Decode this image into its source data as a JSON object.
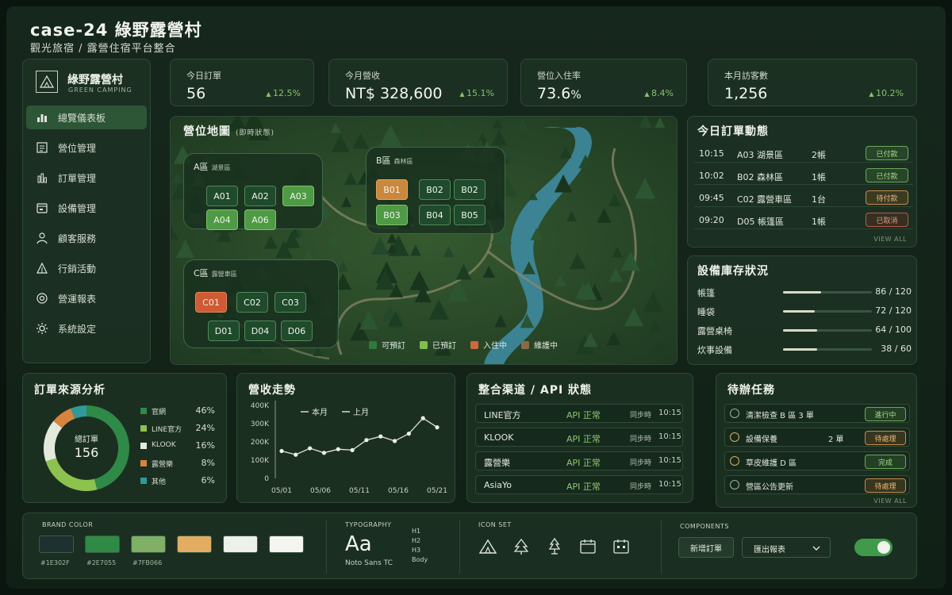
{
  "header": {
    "title": "case-24  綠野露營村",
    "subtitle": "觀光旅宿  /  露營住宿平台整合"
  },
  "sidebar": {
    "brand_name": "綠野露營村",
    "brand_en": "GREEN CAMPING",
    "items": [
      {
        "label": "總覽儀表板",
        "icon": "dashboard-icon",
        "active": true
      },
      {
        "label": "營位管理",
        "icon": "site-grid-icon"
      },
      {
        "label": "訂單管理",
        "icon": "orders-icon"
      },
      {
        "label": "設備管理",
        "icon": "equipment-icon"
      },
      {
        "label": "顧客服務",
        "icon": "customer-icon"
      },
      {
        "label": "行銷活動",
        "icon": "marketing-icon"
      },
      {
        "label": "營運報表",
        "icon": "report-icon"
      },
      {
        "label": "系統設定",
        "icon": "gear-icon"
      }
    ]
  },
  "kpis": [
    {
      "label": "今日訂單",
      "value": "56",
      "unit": "",
      "trend": "12.5%"
    },
    {
      "label": "今月營收",
      "value": "NT$ 328,600",
      "unit": "",
      "trend": "15.1%"
    },
    {
      "label": "營位入住率",
      "value": "73.6",
      "unit": "%",
      "trend": "8.4%"
    },
    {
      "label": "本月訪客數",
      "value": "1,256",
      "unit": "",
      "trend": "10.2%"
    }
  ],
  "map": {
    "title": "營位地圖",
    "subtitle": "(即時狀態)",
    "zones": [
      {
        "name": "A區",
        "sub": "湖景區",
        "sites": [
          {
            "id": "A01",
            "status": "avail"
          },
          {
            "id": "A02",
            "status": "avail"
          },
          {
            "id": "A03",
            "status": "booked"
          },
          {
            "id": "A04",
            "status": "booked"
          },
          {
            "id": "A06",
            "status": "booked"
          }
        ]
      },
      {
        "name": "B區",
        "sub": "森林區",
        "sites": [
          {
            "id": "B01",
            "status": "maint"
          },
          {
            "id": "B02",
            "status": "avail"
          },
          {
            "id": "B02",
            "status": "avail"
          },
          {
            "id": "B03",
            "status": "booked"
          },
          {
            "id": "B04",
            "status": "avail"
          },
          {
            "id": "B05",
            "status": "avail"
          }
        ]
      },
      {
        "name": "C區",
        "sub": "露營車區",
        "sites": [
          {
            "id": "C01",
            "status": "occ"
          },
          {
            "id": "C02",
            "status": "avail"
          },
          {
            "id": "C03",
            "status": "avail"
          },
          {
            "id": "D01",
            "status": "avail"
          },
          {
            "id": "D04",
            "status": "avail"
          },
          {
            "id": "D06",
            "status": "avail"
          }
        ]
      }
    ],
    "legend": [
      {
        "label": "可預訂",
        "color": "#2e7a3c"
      },
      {
        "label": "已預訂",
        "color": "#7fbf4e"
      },
      {
        "label": "入住中",
        "color": "#d0683c"
      },
      {
        "label": "維護中",
        "color": "#8a6a48"
      }
    ]
  },
  "orders": {
    "title": "今日訂單動態",
    "rows": [
      {
        "time": "10:15",
        "site": "A03 湖景區",
        "qty": "2帳",
        "status": "已付款",
        "tone": "green"
      },
      {
        "time": "10:02",
        "site": "B02 森林區",
        "qty": "1帳",
        "status": "已付款",
        "tone": "green"
      },
      {
        "time": "09:45",
        "site": "C02 露營車區",
        "qty": "1台",
        "status": "待付款",
        "tone": "orange"
      },
      {
        "time": "09:20",
        "site": "D05 帳篷區",
        "qty": "1帳",
        "status": "已取消",
        "tone": "red"
      }
    ],
    "view_all": "VIEW ALL"
  },
  "inventory": {
    "title": "設備庫存狀況",
    "rows": [
      {
        "name": "帳篷",
        "used": 86,
        "total": 120,
        "text": "86 / 120"
      },
      {
        "name": "睡袋",
        "used": 72,
        "total": 120,
        "text": "72 / 120"
      },
      {
        "name": "露營桌椅",
        "used": 64,
        "total": 100,
        "text": "64 / 100"
      },
      {
        "name": "炊事設備",
        "used": 38,
        "total": 60,
        "text": "38 /  60"
      }
    ]
  },
  "sources": {
    "title": "訂單來源分析",
    "center_label": "總訂單",
    "center_value": "156",
    "items": [
      {
        "label": "官網",
        "pct": 46,
        "text": "46%",
        "color": "#2f8a47"
      },
      {
        "label": "LINE官方",
        "pct": 24,
        "text": "24%",
        "color": "#8cc24e"
      },
      {
        "label": "KLOOK",
        "pct": 16,
        "text": "16%",
        "color": "#e4eadb"
      },
      {
        "label": "露營樂",
        "pct": 8,
        "text": "8%",
        "color": "#d8843c"
      },
      {
        "label": "其他",
        "pct": 6,
        "text": "6%",
        "color": "#2e9a9a"
      }
    ]
  },
  "chart_data": {
    "type": "line",
    "title": "營收走勢",
    "legend": [
      "本月",
      "上月"
    ],
    "x": [
      "05/01",
      "05/06",
      "05/11",
      "05/16",
      "05/21"
    ],
    "xlabels": [
      "05/01",
      "05/06",
      "05/11",
      "05/16",
      "05/21"
    ],
    "yticks": [
      "400K",
      "300K",
      "200K",
      "100K",
      "0"
    ],
    "ylim": [
      0,
      400
    ],
    "series": [
      {
        "name": "本月",
        "values": [
          150,
          130,
          165,
          140,
          160,
          155,
          210,
          230,
          205,
          245,
          330,
          280
        ]
      }
    ]
  },
  "api": {
    "title": "整合渠道 / API 狀態",
    "rows": [
      {
        "channel": "LINE官方",
        "status": "API 正常",
        "sync": "同步時",
        "time": "10:15"
      },
      {
        "channel": "KLOOK",
        "status": "API 正常",
        "sync": "同步時",
        "time": "10:15"
      },
      {
        "channel": "露營樂",
        "status": "API 正常",
        "sync": "同步時",
        "time": "10:15"
      },
      {
        "channel": "AsiaYo",
        "status": "API 正常",
        "sync": "同步時",
        "time": "10:15"
      }
    ]
  },
  "tasks": {
    "title": "待辦任務",
    "rows": [
      {
        "text": "清潔檢查 B 區 3 單",
        "count": "",
        "status": "進行中",
        "tone": "green",
        "done": false
      },
      {
        "text": "設備保養",
        "count": "2 單",
        "status": "待處理",
        "tone": "orange",
        "done": true
      },
      {
        "text": "草皮維護 D 區",
        "count": "",
        "status": "完成",
        "tone": "green",
        "done": true
      },
      {
        "text": "營區公告更新",
        "count": "",
        "status": "待處理",
        "tone": "orange",
        "done": false
      }
    ],
    "view_all": "VIEW ALL"
  },
  "design": {
    "brand_label": "BRAND COLOR",
    "colors": [
      {
        "hex": "#1E302F",
        "color": "#1e302f"
      },
      {
        "hex": "#2E7055",
        "color": "#2e8a45"
      },
      {
        "hex": "#7FB066",
        "color": "#7fb066"
      },
      {
        "hex": "",
        "color": "#e2ad62"
      },
      {
        "hex": "",
        "color": "#eef0ea"
      },
      {
        "hex": "",
        "color": "#f4f5f1"
      }
    ],
    "typography_label": "TYPOGRAPHY",
    "type_sample": "Aa",
    "type_font": "Noto Sans TC",
    "type_levels": [
      "H1",
      "H2",
      "H3",
      "Body"
    ],
    "iconset_label": "ICON SET",
    "icons": [
      "tent-icon",
      "tree-icon",
      "pine-icon",
      "calendar-icon",
      "calendar-check-icon"
    ],
    "components_label": "COMPONENTS",
    "primary_button": "新增訂單",
    "export_select": "匯出報表",
    "toggle_on": true
  }
}
